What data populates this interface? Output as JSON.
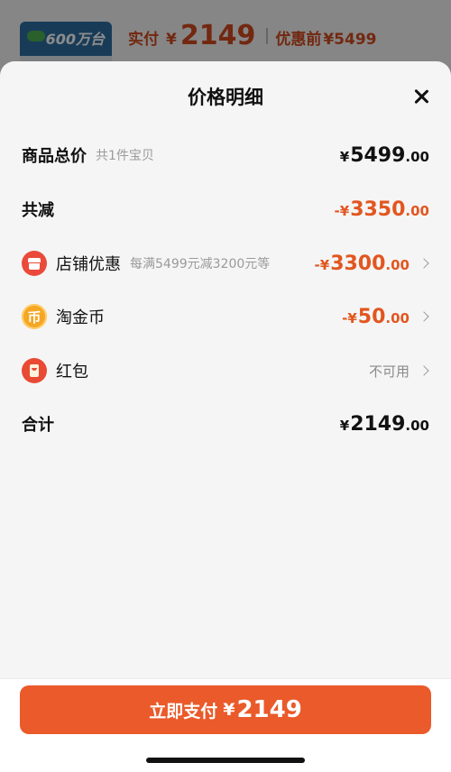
{
  "header": {
    "thumbnail_badge": "600万台",
    "paid_label": "实付",
    "currency": "¥",
    "paid_amount": "2149",
    "original_label": "优惠前",
    "original_amount": "¥5499"
  },
  "sheet": {
    "title": "价格明细",
    "close_icon": "close-icon"
  },
  "rows": {
    "total": {
      "label": "商品总价",
      "sub": "共1件宝贝",
      "yen": "¥",
      "int": "5499",
      "dec": ".00"
    },
    "discount": {
      "label": "共减",
      "yen": "-¥",
      "int": "3350",
      "dec": ".00"
    },
    "shop_promo": {
      "icon": "store-icon",
      "label": "店铺优惠",
      "sub": "每满5499元减3200元等",
      "yen": "-¥",
      "int": "3300",
      "dec": ".00"
    },
    "taojinbi": {
      "icon": "coin-icon",
      "icon_glyph": "币",
      "label": "淘金币",
      "yen": "-¥",
      "int": "50",
      "dec": ".00"
    },
    "red_packet": {
      "icon": "red-packet-icon",
      "label": "红包",
      "status": "不可用"
    },
    "subtotal": {
      "label": "合计",
      "yen": "¥",
      "int": "2149",
      "dec": ".00"
    }
  },
  "footer": {
    "pay_label": "立即支付",
    "pay_yen": "¥",
    "pay_amount": "2149"
  },
  "colors": {
    "accent": "#ea5a2a",
    "discount_red": "#e2561f",
    "sheet_bg": "#f5f5f5"
  }
}
